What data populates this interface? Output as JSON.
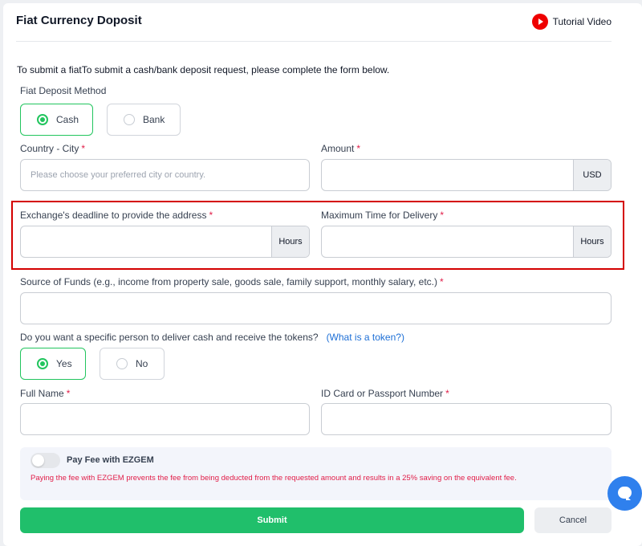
{
  "header": {
    "title": "Fiat Currency Doposit",
    "tutorial_label": "Tutorial Video",
    "tutorial_icon": "youtube-play-icon"
  },
  "form": {
    "intro": "To submit a fiatTo submit a cash/bank deposit request, please complete the form below.",
    "deposit_method": {
      "label": "Fiat Deposit Method",
      "options": [
        "Cash",
        "Bank"
      ],
      "selected": "Cash"
    },
    "country_city": {
      "label": "Country - City",
      "placeholder": "Please choose your preferred city or country.",
      "value": ""
    },
    "amount": {
      "label": "Amount",
      "unit": "USD",
      "value": ""
    },
    "exchange_deadline": {
      "label": "Exchange's deadline to provide the address",
      "unit": "Hours",
      "value": ""
    },
    "max_delivery_time": {
      "label": "Maximum Time for Delivery",
      "unit": "Hours",
      "value": ""
    },
    "source_of_funds": {
      "label": "Source of Funds (e.g., income from property sale, goods sale, family support, monthly salary, etc.)",
      "value": ""
    },
    "specific_person": {
      "question": "Do you want a specific person to deliver cash and receive the tokens?",
      "link": "(What is a token?)",
      "options": [
        "Yes",
        "No"
      ],
      "selected": "Yes"
    },
    "full_name": {
      "label": "Full Name",
      "value": ""
    },
    "id_number": {
      "label": "ID Card or Passport Number",
      "value": ""
    },
    "required_mark": "*"
  },
  "fee": {
    "toggle_label": "Pay Fee with EZGEM",
    "toggle_on": false,
    "note": "Paying the fee with EZGEM prevents the fee from being deducted from the requested amount and results in a 25% saving on the equivalent fee."
  },
  "actions": {
    "submit_label": "Submit",
    "cancel_label": "Cancel"
  },
  "colors": {
    "accent_green": "#20bf6b",
    "required_red": "#e11d48",
    "link_blue": "#1d6fd6",
    "highlight_red": "#d40000",
    "chat_blue": "#2f80ed"
  }
}
